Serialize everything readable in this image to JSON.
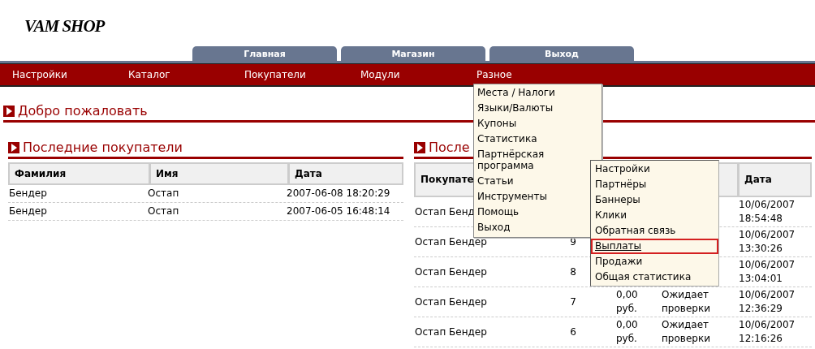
{
  "logo": "VAM SHOP",
  "tabs": [
    {
      "label": "Главная"
    },
    {
      "label": "Магазин"
    },
    {
      "label": "Выход"
    }
  ],
  "nav": [
    {
      "label": "Настройки"
    },
    {
      "label": "Каталог"
    },
    {
      "label": "Покупатели"
    },
    {
      "label": "Модули"
    },
    {
      "label": "Разное",
      "menu": [
        {
          "label": "Места / Налоги"
        },
        {
          "label": "Языки/Валюты"
        },
        {
          "label": "Купоны"
        },
        {
          "label": "Статистика"
        },
        {
          "label": "Партнёрская программа",
          "submenu": [
            {
              "label": "Настройки",
              "selected": false
            },
            {
              "label": "Партнёры",
              "selected": false
            },
            {
              "label": "Баннеры",
              "selected": false
            },
            {
              "label": "Клики",
              "selected": false
            },
            {
              "label": "Обратная связь",
              "selected": false
            },
            {
              "label": "Выплаты",
              "selected": true
            },
            {
              "label": "Продажи",
              "selected": false
            },
            {
              "label": "Общая статистика",
              "selected": false
            }
          ]
        },
        {
          "label": "Статьи"
        },
        {
          "label": "Инструменты"
        },
        {
          "label": "Помощь"
        },
        {
          "label": "Выход"
        }
      ]
    }
  ],
  "welcome": "Добро пожаловать",
  "customers": {
    "title": "Последние покупатели",
    "columns": [
      "Фамилия",
      "Имя",
      "Дата"
    ],
    "rows": [
      [
        "Бендер",
        "Остап",
        "2007-06-08 18:20:29"
      ],
      [
        "Бендер",
        "Остап",
        "2007-06-05 16:48:14"
      ]
    ]
  },
  "orders": {
    "title": "После",
    "columns": [
      "Покупате",
      "",
      "",
      "",
      "Дата"
    ],
    "rows": [
      [
        "Остап Бенд",
        "",
        "",
        "",
        "10/06/2007 18:54:48"
      ],
      [
        "Остап Бендер",
        "9",
        "",
        "",
        "10/06/2007 13:30:26"
      ],
      [
        "Остап Бендер",
        "8",
        "",
        "",
        "10/06/2007 13:04:01"
      ],
      [
        "Остап Бендер",
        "7",
        "0,00 руб.",
        "Ожидает проверки",
        "10/06/2007 12:36:29"
      ],
      [
        "Остап Бендер",
        "6",
        "0,00 руб.",
        "Ожидает проверки",
        "10/06/2007 12:16:26"
      ]
    ]
  }
}
